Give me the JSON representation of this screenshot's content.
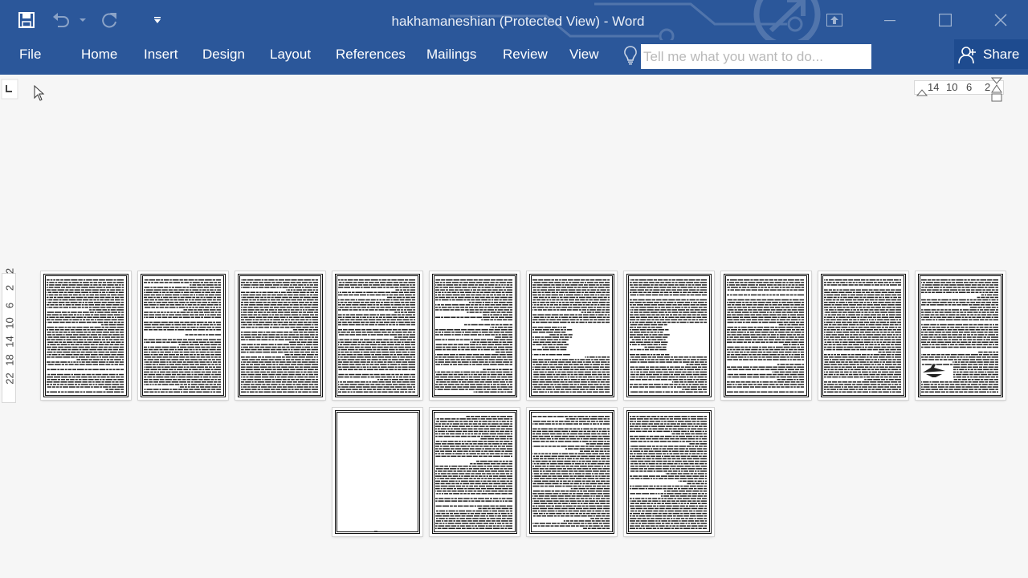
{
  "window": {
    "title": "hakhamaneshian (Protected View) - Word"
  },
  "quick_access": [
    {
      "name": "save-icon"
    },
    {
      "name": "undo-icon"
    },
    {
      "name": "redo-icon"
    },
    {
      "name": "customize-toolbar-icon"
    }
  ],
  "window_controls": [
    {
      "name": "ribbon-display-options-icon"
    },
    {
      "name": "minimize-icon"
    },
    {
      "name": "maximize-icon"
    },
    {
      "name": "close-icon"
    }
  ],
  "ribbon": {
    "tabs": [
      {
        "label": "File"
      },
      {
        "label": "Home"
      },
      {
        "label": "Insert"
      },
      {
        "label": "Design"
      },
      {
        "label": "Layout"
      },
      {
        "label": "References"
      },
      {
        "label": "Mailings"
      },
      {
        "label": "Review"
      },
      {
        "label": "View"
      }
    ],
    "tell_me": {
      "placeholder": "Tell me what you want to do...",
      "value": "",
      "icon": "lightbulb-icon"
    },
    "share": {
      "label": "Share",
      "icon": "person-icon"
    }
  },
  "rulers": {
    "horizontal": [
      "14",
      "10",
      "6",
      "2"
    ],
    "vertical": [
      "2",
      "2",
      "6",
      "10",
      "14",
      "18",
      "22"
    ]
  },
  "pages": [
    {
      "n": 1,
      "content": "text"
    },
    {
      "n": 2,
      "content": "text"
    },
    {
      "n": 3,
      "content": "text"
    },
    {
      "n": 4,
      "content": "text"
    },
    {
      "n": 5,
      "content": "text"
    },
    {
      "n": 6,
      "content": "text-with-figure"
    },
    {
      "n": 7,
      "content": "text-with-figure"
    },
    {
      "n": 8,
      "content": "text"
    },
    {
      "n": 9,
      "content": "text"
    },
    {
      "n": 10,
      "content": "text-with-emblem"
    },
    {
      "n": 11,
      "content": "blank"
    },
    {
      "n": 12,
      "content": "text"
    },
    {
      "n": 13,
      "content": "text"
    },
    {
      "n": 14,
      "content": "text"
    }
  ],
  "colors": {
    "accent": "#2b579a",
    "share_bg": "#1e4b8f",
    "canvas": "#f6f6f6"
  }
}
